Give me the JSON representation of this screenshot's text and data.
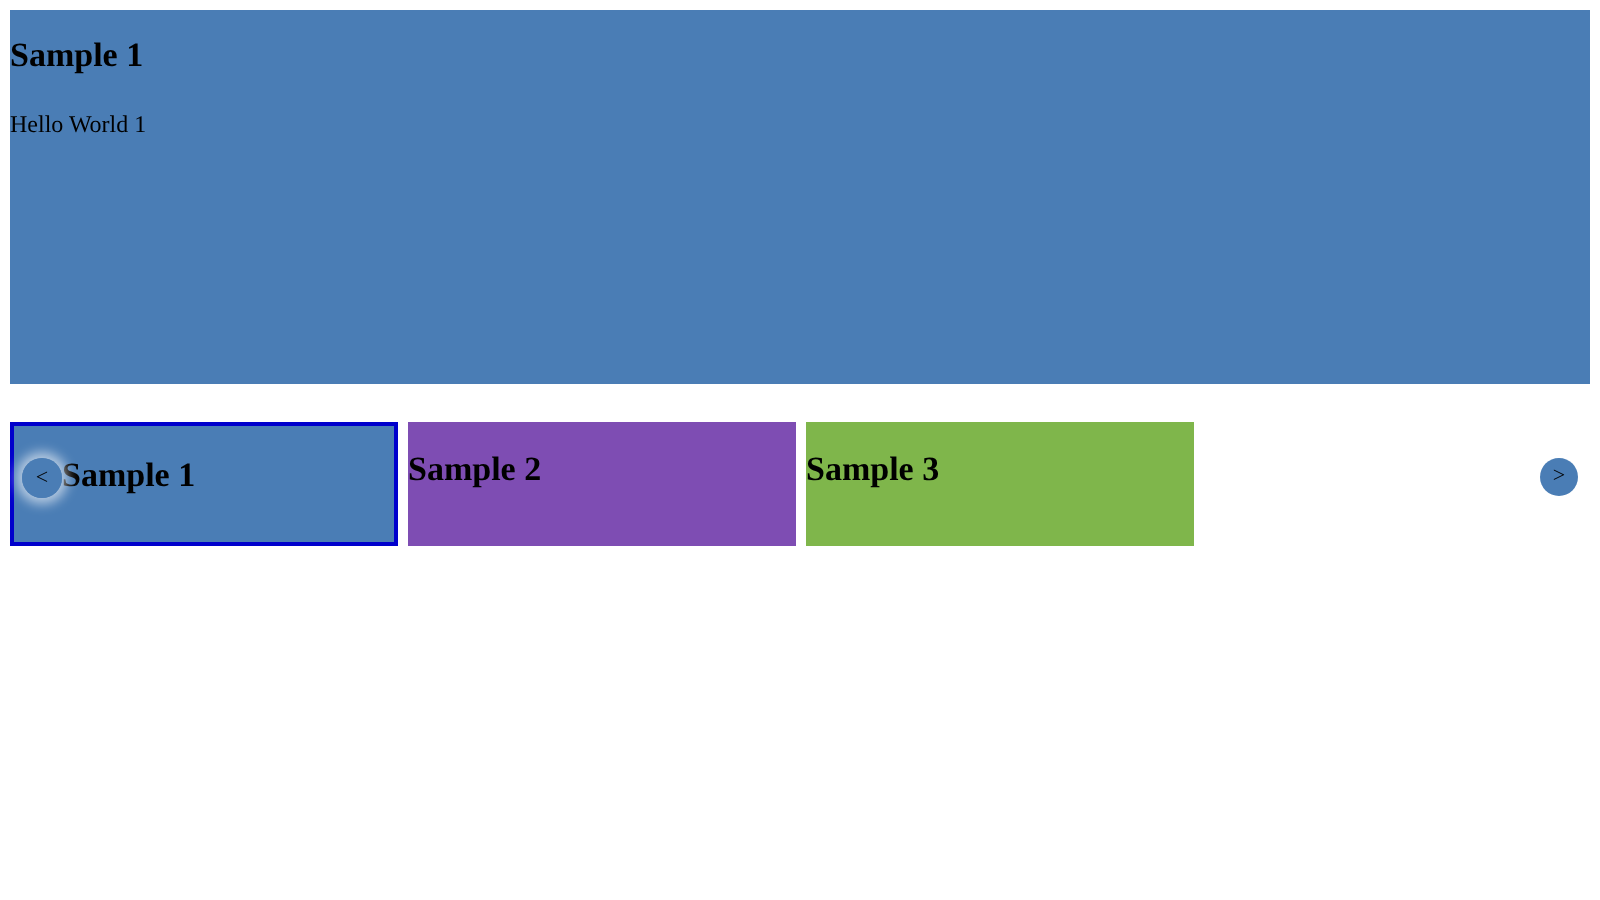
{
  "main_slide": {
    "title": "Sample 1",
    "text": "Hello World 1",
    "color": "#4a7db5"
  },
  "thumbnails": [
    {
      "title": "Sample 1",
      "color": "#4a7db5",
      "selected": true
    },
    {
      "title": "Sample 2",
      "color": "#7e4db3",
      "selected": false
    },
    {
      "title": "Sample 3",
      "color": "#7fb64b",
      "selected": false
    }
  ],
  "prev_button": "<",
  "next_button": ">"
}
